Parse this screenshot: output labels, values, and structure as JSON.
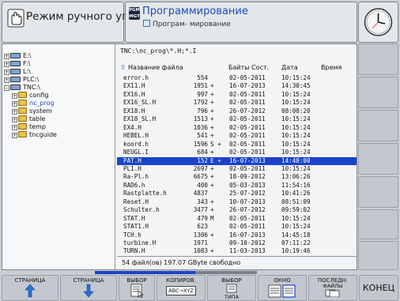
{
  "header": {
    "mode_title": "Режим ручного уп...",
    "pgm_badge": "PGM MGT",
    "prog_title": "Программирование",
    "prog_subtitle": "Програм- мирование"
  },
  "tree": {
    "items": [
      {
        "label": "E:\\"
      },
      {
        "label": "F:\\"
      },
      {
        "label": "L:\\"
      },
      {
        "label": "PLC:\\"
      },
      {
        "label": "TNC:\\"
      },
      {
        "label": "config"
      },
      {
        "label": "nc_prog"
      },
      {
        "label": "system"
      },
      {
        "label": "table"
      },
      {
        "label": "temp"
      },
      {
        "label": "tncguide"
      }
    ]
  },
  "files": {
    "path": "TNC:\\nc_prog\\*.H;*.I",
    "headers": {
      "name": "Название файла",
      "size": "Байты",
      "status": "Сост.",
      "date": "Дата",
      "time": "Время"
    },
    "rows": [
      {
        "name": "error.h",
        "size": "554",
        "status": "",
        "date": "02-05-2011",
        "time": "10:15:24"
      },
      {
        "name": "EX11.H",
        "size": "1951",
        "status": "+",
        "date": "16-07-2013",
        "time": "14:30:45"
      },
      {
        "name": "EX16.H",
        "size": "997",
        "status": "+",
        "date": "02-05-2011",
        "time": "10:15:24"
      },
      {
        "name": "EX16_SL.H",
        "size": "1792",
        "status": "+",
        "date": "02-05-2011",
        "time": "10:15:24"
      },
      {
        "name": "EX18.H",
        "size": "796",
        "status": "+",
        "date": "26-07-2012",
        "time": "08:08:20"
      },
      {
        "name": "EX18_SL.H",
        "size": "1513",
        "status": "+",
        "date": "02-05-2011",
        "time": "10:15:24"
      },
      {
        "name": "EX4.H",
        "size": "1036",
        "status": "+",
        "date": "02-05-2011",
        "time": "10:15:24"
      },
      {
        "name": "HEBEL.H",
        "size": "541",
        "status": "+",
        "date": "02-05-2011",
        "time": "10:15:24"
      },
      {
        "name": "koord.h",
        "size": "1596",
        "status": "S +",
        "date": "02-05-2011",
        "time": "10:15:24"
      },
      {
        "name": "NEUGL.I",
        "size": "684",
        "status": "+",
        "date": "02-05-2011",
        "time": "10:15:24"
      },
      {
        "name": "PAT.H",
        "size": "152",
        "status": "E +",
        "date": "16-07-2013",
        "time": "14:48:00"
      },
      {
        "name": "PL1.H",
        "size": "2697",
        "status": "+",
        "date": "02-05-2011",
        "time": "10:15:24"
      },
      {
        "name": "Ra-Pl.h",
        "size": "6675",
        "status": "+",
        "date": "18-09-2012",
        "time": "13:06:26"
      },
      {
        "name": "RAD6.h",
        "size": "400",
        "status": "+",
        "date": "05-03-2013",
        "time": "11:54:16"
      },
      {
        "name": "Rastplatte.h",
        "size": "4837",
        "status": "",
        "date": "25-07-2012",
        "time": "10:41:26"
      },
      {
        "name": "Reset.H",
        "size": "343",
        "status": "+",
        "date": "10-07-2013",
        "time": "08:51:09"
      },
      {
        "name": "Schulter.h",
        "size": "3477",
        "status": "+",
        "date": "26-07-2012",
        "time": "09:59:02"
      },
      {
        "name": "STAT.H",
        "size": "479",
        "status": "M",
        "date": "02-05-2011",
        "time": "10:15:24"
      },
      {
        "name": "STAT1.H",
        "size": "623",
        "status": "",
        "date": "02-05-2011",
        "time": "10:15:24"
      },
      {
        "name": "TCH.h",
        "size": "1306",
        "status": "+",
        "date": "16-07-2013",
        "time": "14:45:18"
      },
      {
        "name": "turbine.H",
        "size": "1971",
        "status": "",
        "date": "09-10-2012",
        "time": "07:11:22"
      },
      {
        "name": "TURN.H",
        "size": "1083",
        "status": "+",
        "date": "11-03-2013",
        "time": "10:19:46"
      }
    ],
    "selected_index": 10,
    "status": "54 файл(ов) 197.07 GByte свободно"
  },
  "softkeys": {
    "page_up": "СТРАНИЦА",
    "page_down": "СТРАНИЦА",
    "select": "ВЫБОР",
    "copy": "КОПИРОВ.",
    "copy_icon": "ABC→XYZ",
    "select_type_top": "ВЫБОР",
    "select_type_bottom": "ТИПА",
    "window": "ОКНО",
    "last_files_top": "ПОСЛЕДН.",
    "last_files_bottom": "ФАЙЛЫ",
    "end": "КОНЕЦ"
  },
  "scroll_progress": 0.62,
  "colors": {
    "selection": "#1a43c8",
    "title_blue": "#1e4bb8"
  }
}
